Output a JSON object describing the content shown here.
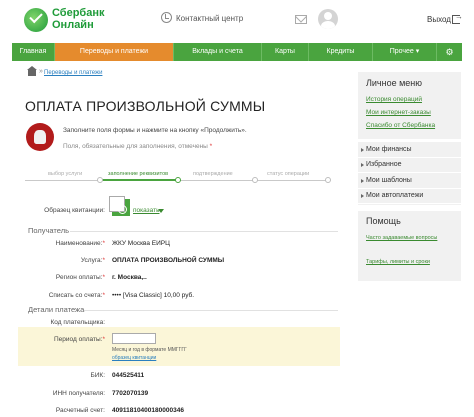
{
  "header": {
    "logo_line1": "Сбербанк",
    "logo_line2": "Онлайн",
    "contact": "Контактный центр",
    "exit": "Выход"
  },
  "nav": [
    "Главная",
    "Переводы и платежи",
    "Вклады и счета",
    "Карты",
    "Кредиты",
    "Прочее ▾"
  ],
  "breadcrumb": {
    "sep": "»",
    "link": "Переводы и платежи"
  },
  "page": {
    "title": "ОПЛАТА ПРОИЗВОЛЬНОЙ СУММЫ",
    "instruction": "Заполните поля формы и нажмите на кнопку «Продолжить».",
    "required_note": "Поля, обязательные для заполнения, отмечены",
    "required_star": "*"
  },
  "steps": [
    "выбор услуги",
    "заполнение реквизитов",
    "подтверждение",
    "статус операции"
  ],
  "receipt": {
    "label": "Образец квитанции:",
    "show": "показать"
  },
  "recipient": {
    "section": "Получатель",
    "rows": [
      {
        "label": "Наименование:",
        "value": "ЖКУ Москва ЕИРЦ"
      },
      {
        "label": "Услуга:",
        "value": "ОПЛАТА ПРОИЗВОЛЬНОЙ СУММЫ"
      },
      {
        "label": "Регион оплаты:",
        "value": "г. Москва,.."
      },
      {
        "label": "Списать со счета:",
        "value": "••••          [Visa Classic] 10,00   руб."
      }
    ]
  },
  "details": {
    "section": "Детали платежа",
    "payer_code_label": "Код плательщика:",
    "period_label": "Период оплаты:",
    "period_hint": "Месяц и год в формате ММГГГГ",
    "period_sample": "образец квитанции",
    "rows": [
      {
        "label": "БИК:",
        "value": "044525411"
      },
      {
        "label": "ИНН получателя:",
        "value": "7702070139"
      },
      {
        "label": "Расчетный счет:",
        "value": "40911810400180000346"
      }
    ]
  },
  "sidebar": {
    "personal_menu": "Личное меню",
    "links": [
      "История операций",
      "Мои интернет-заказы",
      "Спасибо от Сбербанка"
    ],
    "menu": [
      "Мои финансы",
      "Избранное",
      "Мои шаблоны",
      "Мои автоплатежи"
    ],
    "help_title": "Помощь",
    "help_links": [
      "Часто задаваемые вопросы",
      "Тарифы, лимиты и сроки"
    ]
  }
}
